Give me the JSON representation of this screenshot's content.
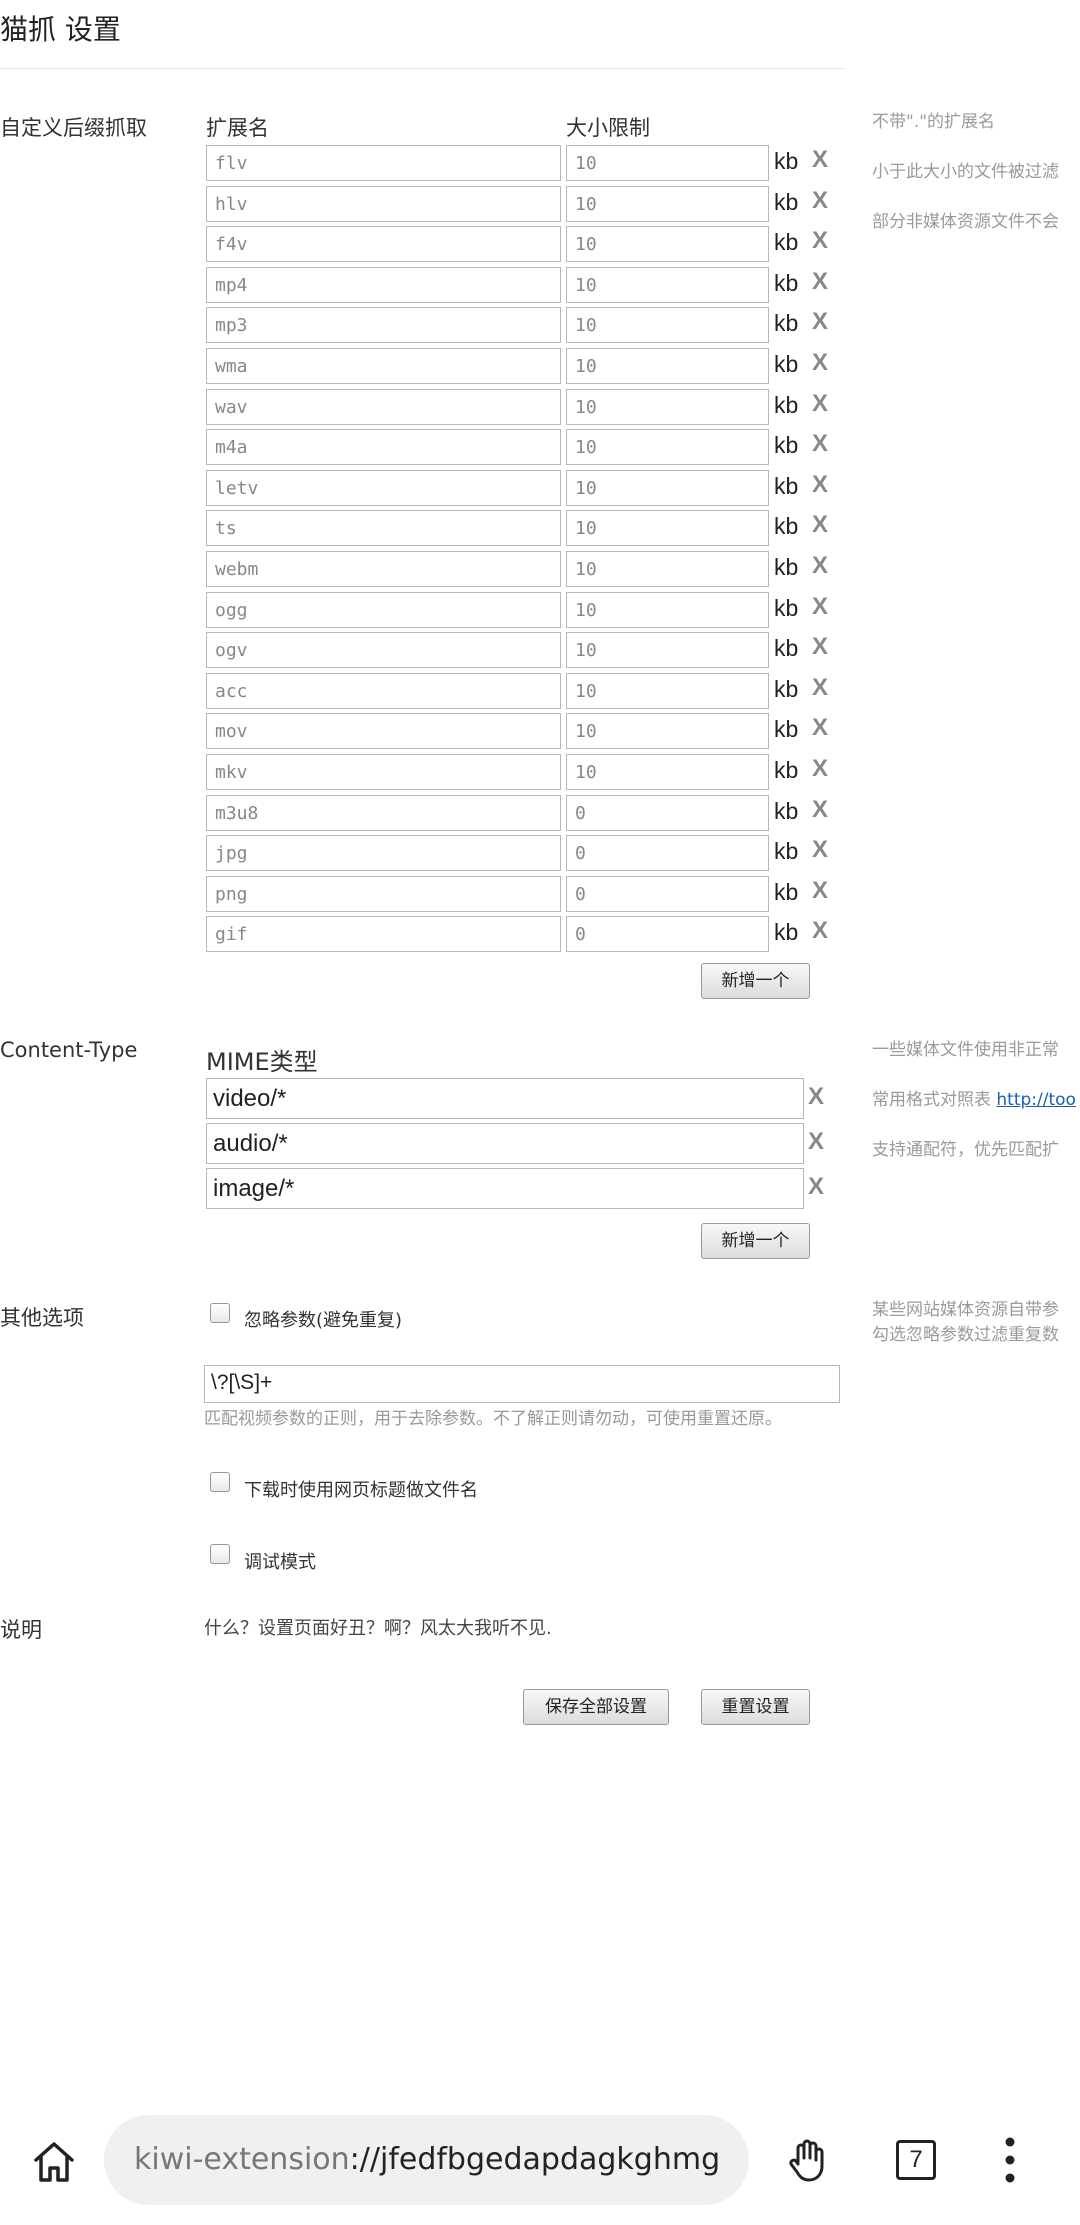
{
  "page": {
    "title": "猫抓 设置"
  },
  "extensions": {
    "label": "自定义后缀抓取",
    "col_ext": "扩展名",
    "col_size": "大小限制",
    "unit": "kb",
    "delete_glyph": "X",
    "rows": [
      {
        "ext": "flv",
        "size": "10"
      },
      {
        "ext": "hlv",
        "size": "10"
      },
      {
        "ext": "f4v",
        "size": "10"
      },
      {
        "ext": "mp4",
        "size": "10"
      },
      {
        "ext": "mp3",
        "size": "10"
      },
      {
        "ext": "wma",
        "size": "10"
      },
      {
        "ext": "wav",
        "size": "10"
      },
      {
        "ext": "m4a",
        "size": "10"
      },
      {
        "ext": "letv",
        "size": "10"
      },
      {
        "ext": "ts",
        "size": "10"
      },
      {
        "ext": "webm",
        "size": "10"
      },
      {
        "ext": "ogg",
        "size": "10"
      },
      {
        "ext": "ogv",
        "size": "10"
      },
      {
        "ext": "acc",
        "size": "10"
      },
      {
        "ext": "mov",
        "size": "10"
      },
      {
        "ext": "mkv",
        "size": "10"
      },
      {
        "ext": "m3u8",
        "size": "0"
      },
      {
        "ext": "jpg",
        "size": "0"
      },
      {
        "ext": "png",
        "size": "0"
      },
      {
        "ext": "gif",
        "size": "0"
      }
    ],
    "add_label": "新增一个",
    "hints": [
      "不带\".\"的扩展名",
      "小于此大小的文件被过滤",
      "部分非媒体资源文件不会"
    ]
  },
  "content_type": {
    "label": "Content-Type",
    "col_mime": "MIME类型",
    "delete_glyph": "X",
    "rows": [
      "video/*",
      "audio/*",
      "image/*"
    ],
    "add_label": "新增一个",
    "hints": [
      "一些媒体文件使用非正常",
      "常用格式对照表 ",
      "支持通配符，优先匹配扩"
    ],
    "hint_link": "http://too"
  },
  "other": {
    "label": "其他选项",
    "ignore_params": {
      "label": "忽略参数(避免重复)",
      "checked": false
    },
    "regex_value": "\\?[\\S]+",
    "regex_help": "匹配视频参数的正则，用于去除参数。不了解正则请勿动，可使用重置还原。",
    "title_filename": {
      "label": "下载时使用网页标题做文件名",
      "checked": false
    },
    "debug": {
      "label": "调试模式",
      "checked": false
    },
    "hints": [
      "某些网站媒体资源自带参",
      "勾选忽略参数过滤重复数"
    ]
  },
  "description": {
    "label": "说明",
    "text": "什么？设置页面好丑？啊？风太大我听不见."
  },
  "actions": {
    "save_label": "保存全部设置",
    "reset_label": "重置设置"
  },
  "browser": {
    "url_scheme": "kiwi-extension",
    "url_rest": "://jfedfbgedapdagkghmg",
    "tab_count": "7",
    "icons": [
      "home-icon",
      "hand-icon",
      "tab-switcher-icon",
      "more-menu-icon"
    ]
  }
}
